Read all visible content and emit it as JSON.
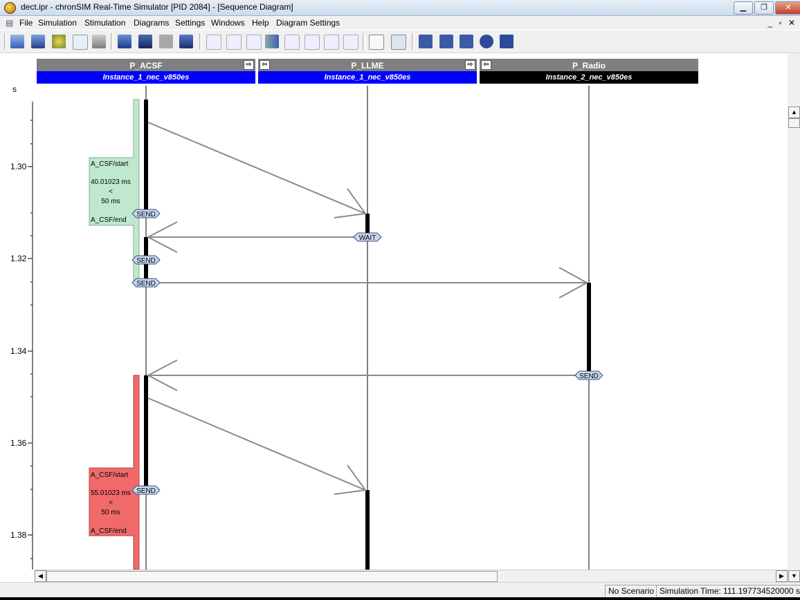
{
  "window": {
    "title": "dect.ipr - chronSIM Real-Time Simulator [PID 2084] - [Sequence Diagram]"
  },
  "menu": [
    "File",
    "Simulation",
    "Stimulation",
    "Diagrams",
    "Settings",
    "Windows",
    "Help",
    "Diagram Settings"
  ],
  "mdi_buttons": "_ ▫ ✕",
  "lanes": [
    {
      "name": "P_ACSF",
      "instance": "Instance_1_nec_v850es",
      "instance_color": "#0000ff"
    },
    {
      "name": "P_LLME",
      "instance": "Instance_1_nec_v850es",
      "instance_color": "#0000ff"
    },
    {
      "name": "P_Radio",
      "instance": "Instance_2_nec_v850es",
      "instance_color": "#000000"
    }
  ],
  "axis": {
    "unit": "s",
    "ticks": [
      "1.30",
      "1.32",
      "1.34",
      "1.36",
      "1.38"
    ]
  },
  "constraints": [
    {
      "start": "A_CSF/start",
      "duration": "40.01023 ms",
      "op": "<",
      "limit": "50 ms",
      "end": "A_CSF/end",
      "color": "#bfe8cf"
    },
    {
      "start": "A_CSF/start",
      "duration": "55.01023 ms",
      "op": "<",
      "limit": "50 ms",
      "end": "A_CSF/end",
      "color": "#f06a6a"
    }
  ],
  "events": {
    "send": "SEND",
    "wait": "WAIT"
  },
  "status": {
    "scenario": "No Scenario",
    "sim_time": "Simulation Time: 111.197734520000 s"
  },
  "colors": {
    "arrow": "#8a8a8a",
    "activation": "#000000"
  }
}
